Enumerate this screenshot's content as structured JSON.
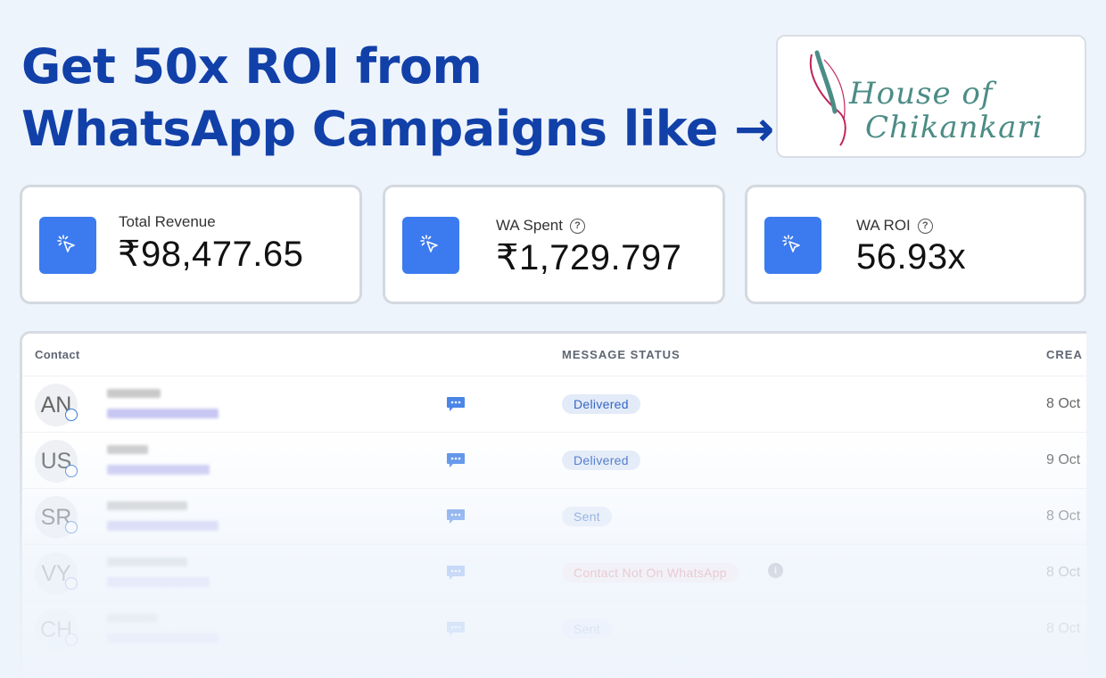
{
  "headline": {
    "line1": "Get 50x ROI from",
    "line2": "WhatsApp Campaigns like →"
  },
  "logo": {
    "line1": "House of",
    "line2": "Chikankari"
  },
  "stats": [
    {
      "label": "Total Revenue",
      "value": "₹98,477.65",
      "icon": "cursor-click-icon",
      "help": false
    },
    {
      "label": "WA Spent",
      "value": "₹1,729.797",
      "icon": "cursor-click-icon",
      "help": true
    },
    {
      "label": "WA ROI",
      "value": "56.93x",
      "icon": "cursor-click-icon",
      "help": true
    }
  ],
  "help_glyph": "?",
  "table": {
    "headers": {
      "contact": "Contact",
      "message_status": "MESSAGE STATUS",
      "created": "CREA"
    },
    "rows": [
      {
        "initials": "AN",
        "status": "Delivered",
        "date": "8 Oct"
      },
      {
        "initials": "US",
        "status": "Delivered",
        "date": "9 Oct"
      },
      {
        "initials": "SR",
        "status": "Sent",
        "date": "8 Oct"
      },
      {
        "initials": "VY",
        "status": "Contact Not On WhatsApp",
        "date": "8 Oct",
        "info": "i"
      },
      {
        "initials": "CH",
        "status": "Sent",
        "date": "8 Oct"
      }
    ]
  },
  "colors": {
    "headline": "#1140a8",
    "accent": "#3b7bef",
    "delivered": "#3566c4",
    "error": "#d64545"
  }
}
